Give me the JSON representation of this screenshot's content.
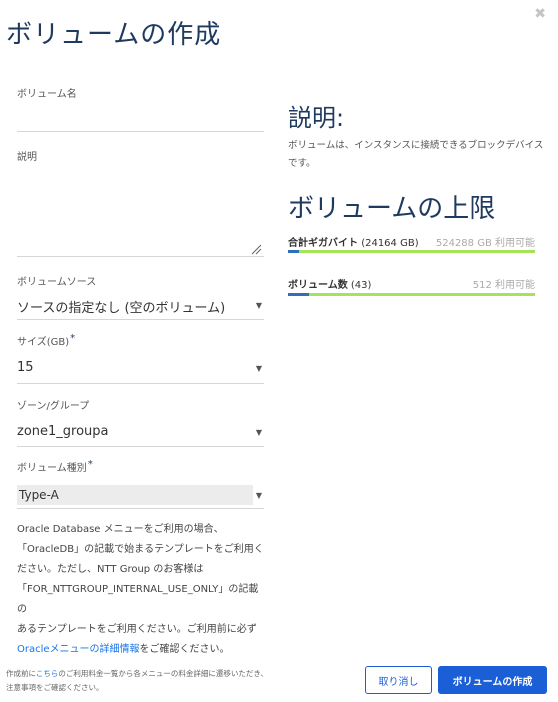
{
  "dialog": {
    "title": "ボリュームの作成",
    "close_glyph": "✖"
  },
  "form": {
    "volume_name": {
      "label": "ボリューム名",
      "value": ""
    },
    "description": {
      "label": "説明",
      "value": ""
    },
    "volume_source": {
      "label": "ボリュームソース",
      "value": "ソースの指定なし (空のボリューム)"
    },
    "size": {
      "label": "サイズ(GB)",
      "required_mark": "*",
      "value": "15"
    },
    "zone": {
      "label": "ゾーン/グループ",
      "value": "zone1_groupa"
    },
    "volume_type": {
      "label": "ボリューム種別",
      "required_mark": "*",
      "value": "Type-A"
    },
    "note": {
      "line1": "Oracle Database メニューをご利用の場合、",
      "line2": "「OracleDB」の記載で始まるテンプレートをご利用く",
      "line3": "ださい。ただし、NTT Group のお客様は",
      "line4": "「FOR_NTTGROUP_INTERNAL_USE_ONLY」の記載の",
      "line5": "あるテンプレートをご利用ください。ご利用前に必ず",
      "link": "Oracleメニューの詳細情報",
      "line6_suffix": "をご確認ください。"
    }
  },
  "info": {
    "description_heading": "説明:",
    "description_text": "ボリュームは、インスタンスに接続できるブロックデバイスです。",
    "limits_heading": "ボリュームの上限",
    "quotas": [
      {
        "label": "合計ギガバイト",
        "used": "(24164 GB)",
        "available": "524288 GB 利用可能",
        "fraction": 0.046
      },
      {
        "label": "ボリューム数",
        "used": "(43)",
        "available": "512 利用可能",
        "fraction": 0.084
      }
    ]
  },
  "footer": {
    "text_prefix": "作成前に",
    "link": "こちら",
    "text_suffix": "のご利用料金一覧から各メニューの料金詳細に遷移いただき、",
    "line2": "注意事項をご確認ください。"
  },
  "buttons": {
    "cancel": "取り消し",
    "create": "ボリュームの作成"
  },
  "icons": {
    "dropdown": "caret-down-icon",
    "resize": "resize-handle-icon",
    "close": "close-icon"
  }
}
